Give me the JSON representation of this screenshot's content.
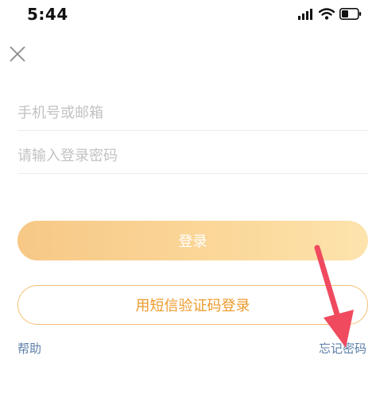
{
  "status_bar": {
    "time": "5:44"
  },
  "form": {
    "phone_placeholder": "手机号或邮箱",
    "password_placeholder": "请输入登录密码",
    "login_label": "登录",
    "sms_login_label": "用短信验证码登录"
  },
  "links": {
    "help": "帮助",
    "forgot_password": "忘记密码"
  },
  "colors": {
    "login_gradient_start": "#f7c886",
    "login_gradient_end": "#fde3ad",
    "sms_border": "#f4bf72",
    "sms_text": "#ee9a2a",
    "link": "#5b7fa8",
    "arrow": "#f04a5f"
  },
  "icons": {
    "close": "close-icon",
    "signal": "signal-icon",
    "wifi": "wifi-icon",
    "battery": "battery-icon",
    "annotation": "red-arrow-annotation"
  }
}
